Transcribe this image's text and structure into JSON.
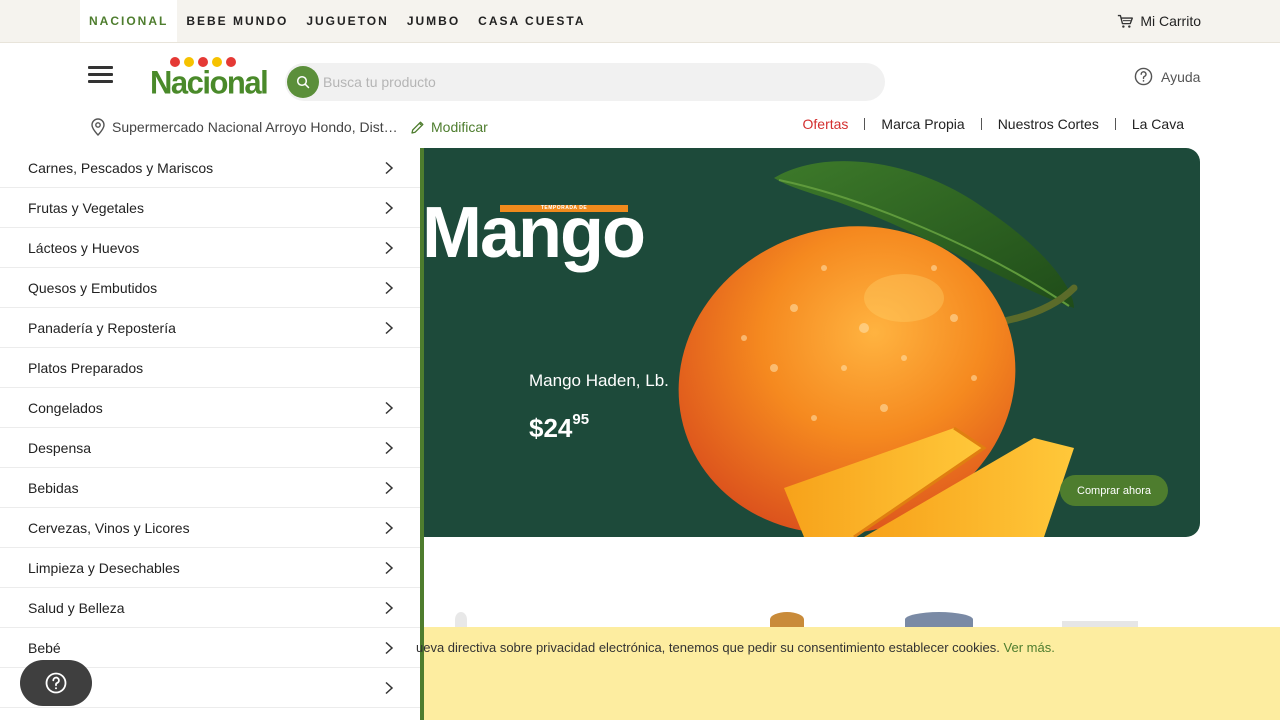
{
  "brand_tabs": [
    {
      "label": "NACIONAL",
      "active": true
    },
    {
      "label": "BEBE MUNDO",
      "active": false
    },
    {
      "label": "JUGUETON",
      "active": false
    },
    {
      "label": "JUMBO",
      "active": false
    },
    {
      "label": "CASA CUESTA",
      "active": false
    }
  ],
  "cart": {
    "label": "Mi Carrito",
    "icon": "cart-icon"
  },
  "header": {
    "logo_text": "Nacional",
    "logo_dot_colors": [
      "#e53935",
      "#f6c200",
      "#e53935",
      "#f6c200",
      "#e53935"
    ],
    "search_placeholder": "Busca tu producto",
    "help_label": "Ayuda"
  },
  "location": {
    "store": "Supermercado Nacional Arroyo Hondo, Distrito Nacional",
    "modify_label": "Modificar"
  },
  "quick_links": [
    "Ofertas",
    "Marca Propia",
    "Nuestros Cortes",
    "La Cava"
  ],
  "categories": [
    {
      "label": "Carnes, Pescados y Mariscos",
      "has_children": true
    },
    {
      "label": "Frutas y Vegetales",
      "has_children": true
    },
    {
      "label": "Lácteos y Huevos",
      "has_children": true
    },
    {
      "label": "Quesos y Embutidos",
      "has_children": true
    },
    {
      "label": "Panadería y Repostería",
      "has_children": true
    },
    {
      "label": "Platos Preparados",
      "has_children": false
    },
    {
      "label": "Congelados",
      "has_children": true
    },
    {
      "label": "Despensa",
      "has_children": true
    },
    {
      "label": "Bebidas",
      "has_children": true
    },
    {
      "label": "Cervezas, Vinos y Licores",
      "has_children": true
    },
    {
      "label": "Limpieza y Desechables",
      "has_children": true
    },
    {
      "label": "Salud y Belleza",
      "has_children": true
    },
    {
      "label": "Bebé",
      "has_children": true
    },
    {
      "label": "",
      "has_children": true
    }
  ],
  "banner": {
    "season_tag": "TEMPORADA DE",
    "title": "Mango",
    "product_name": "Mango Haden, Lb.",
    "price_main": "$24",
    "price_cents": "95",
    "cta": "Comprar ahora",
    "background": "#1d4a3a"
  },
  "cookie": {
    "text": "ueva directiva sobre privacidad electrónica, tenemos que pedir su consentimiento establecer cookies.",
    "link": "Ver más."
  },
  "colors": {
    "brand_green": "#4e7d2e",
    "offer_red": "#d32f2f"
  }
}
